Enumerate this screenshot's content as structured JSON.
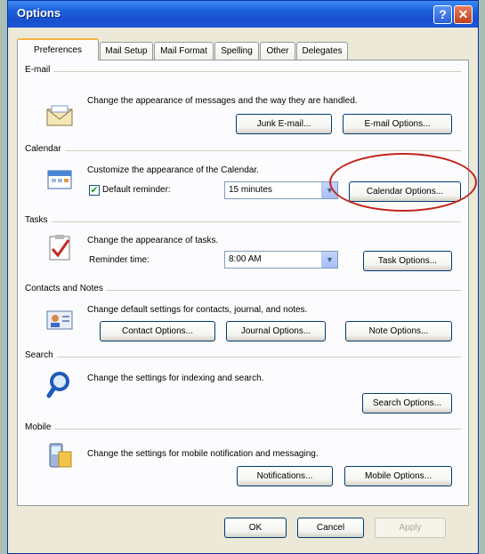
{
  "window": {
    "title": "Options",
    "help_glyph": "?",
    "close_glyph": "✕"
  },
  "tabs": [
    "Preferences",
    "Mail Setup",
    "Mail Format",
    "Spelling",
    "Other",
    "Delegates"
  ],
  "sections": {
    "email": {
      "heading": "E-mail",
      "description": "Change the appearance of messages and the way they are handled.",
      "buttons": [
        "Junk E-mail...",
        "E-mail Options..."
      ]
    },
    "calendar": {
      "heading": "Calendar",
      "description": "Customize the appearance of the Calendar.",
      "checkbox_label": "Default reminder:",
      "reminder_value": "15 minutes",
      "button": "Calendar Options..."
    },
    "tasks": {
      "heading": "Tasks",
      "description": "Change the appearance of tasks.",
      "reminder_label": "Reminder time:",
      "reminder_value": "8:00 AM",
      "button": "Task Options..."
    },
    "contacts": {
      "heading": "Contacts and Notes",
      "description": "Change default settings for contacts, journal, and notes.",
      "buttons": [
        "Contact Options...",
        "Journal Options...",
        "Note Options..."
      ]
    },
    "search": {
      "heading": "Search",
      "description": "Change the settings for indexing and search.",
      "button": "Search Options..."
    },
    "mobile": {
      "heading": "Mobile",
      "description": "Change the settings for mobile notification and messaging.",
      "buttons": [
        "Notifications...",
        "Mobile Options..."
      ]
    }
  },
  "footer": {
    "ok": "OK",
    "cancel": "Cancel",
    "apply": "Apply"
  },
  "colors": {
    "accent_highlight": "#c0261c",
    "titlebar": "#1d62dc"
  },
  "icons": [
    "email-envelope-icon",
    "calendar-icon",
    "tasks-checkmark-icon",
    "contacts-card-icon",
    "search-magnifier-icon",
    "mobile-device-icon"
  ]
}
